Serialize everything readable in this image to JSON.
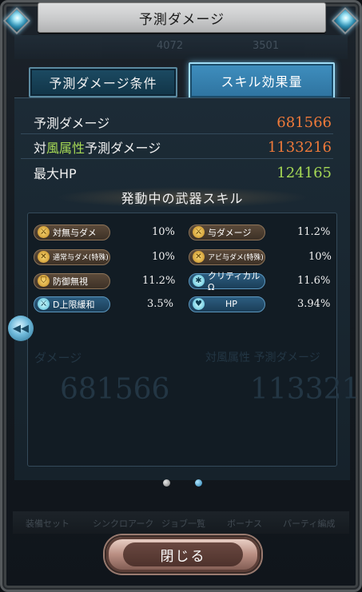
{
  "window": {
    "title": "予測ダメージ"
  },
  "tabs": [
    {
      "label": "予測ダメージ条件",
      "active": false
    },
    {
      "label": "スキル効果量",
      "active": true
    }
  ],
  "background_strip": {
    "num1": "4072",
    "num2": "3501"
  },
  "summary": {
    "predicted_damage": {
      "label": "予測ダメージ",
      "value": "681566",
      "color": "#f07a3a"
    },
    "element_damage": {
      "label_prefix": "対",
      "label_element": "風属性",
      "label_suffix": "予測ダメージ",
      "value": "1133216",
      "color": "#f07a3a",
      "element_color": "#a6d955"
    },
    "max_hp": {
      "label": "最大HP",
      "value": "124165",
      "color": "#a6d955"
    }
  },
  "section_title": "発動中の武器スキル",
  "skills": [
    {
      "label": "対無与ダメ",
      "value": "10%",
      "style": "brown",
      "icon": "sword-icon"
    },
    {
      "label": "与ダメージ",
      "value": "11.2%",
      "style": "brown",
      "icon": "sword-icon"
    },
    {
      "label": "通常与ダメ(特殊)",
      "value": "10%",
      "style": "brown",
      "icon": "swords-icon"
    },
    {
      "label": "アビ与ダメ(特殊)",
      "value": "10%",
      "style": "brown",
      "icon": "swords-icon"
    },
    {
      "label": "防御無視",
      "value": "11.2%",
      "style": "brown",
      "icon": "shield-icon"
    },
    {
      "label": "クリティカルΩ",
      "value": "11.6%",
      "style": "blue",
      "icon": "star-icon"
    },
    {
      "label": "D上限緩和",
      "value": "3.5%",
      "style": "blue",
      "icon": "sword-icon"
    },
    {
      "label": "HP",
      "value": "3.94%",
      "style": "blue",
      "icon": "heart-icon"
    }
  ],
  "ghost_text": {
    "left_label": "ダメージ",
    "left_value": "681566",
    "right_label": "対風属性 予測ダメージ",
    "right_value": "113321"
  },
  "pagination": {
    "current": 2,
    "total": 2
  },
  "bottom_bar": [
    "装備セット",
    "シンクロアーク",
    "ジョブ一覧",
    "ボーナス",
    "パーティ編成"
  ],
  "close_button": {
    "label": "閉じる"
  },
  "side_arrow": {
    "glyph": "◀◀"
  }
}
